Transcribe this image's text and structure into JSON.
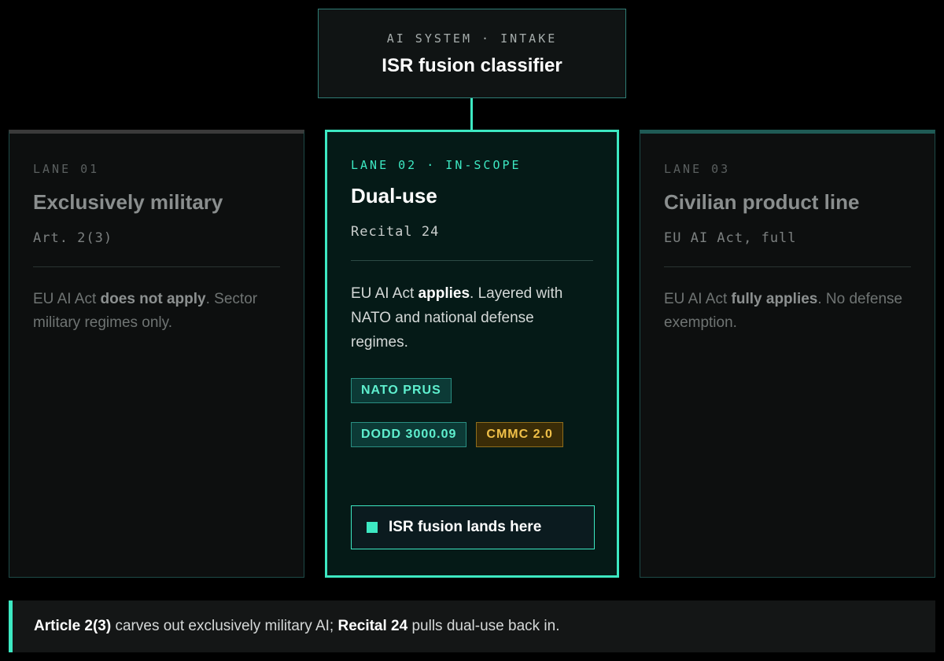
{
  "intake": {
    "kicker": "AI SYSTEM · INTAKE",
    "title": "ISR fusion classifier"
  },
  "lanes": [
    {
      "tag": "LANE 01",
      "title": "Exclusively military",
      "ref": "Art. 2(3)",
      "body_pre": "EU AI Act ",
      "body_bold": "does not apply",
      "body_post": ". Sector military regimes only."
    },
    {
      "tag": "LANE 02 · IN-SCOPE",
      "title": "Dual-use",
      "ref": "Recital 24",
      "body_pre": "EU AI Act ",
      "body_bold": "applies",
      "body_post": ". Layered with NATO and national defense regimes.",
      "tags": [
        "NATO PRUS",
        "DODD 3000.09",
        "CMMC 2.0"
      ],
      "cta": "ISR fusion lands here"
    },
    {
      "tag": "LANE 03",
      "title": "Civilian product line",
      "ref": "EU AI Act, full",
      "body_pre": "EU AI Act ",
      "body_bold": "fully applies",
      "body_post": ". No defense exemption."
    }
  ],
  "note": {
    "bold1": "Article 2(3)",
    "text1": " carves out exclusively military AI; ",
    "bold2": "Recital 24",
    "text2": " pulls dual-use back in."
  },
  "colors": {
    "accent": "#3de8c2",
    "amber": "#f0c048",
    "background": "#000000"
  }
}
